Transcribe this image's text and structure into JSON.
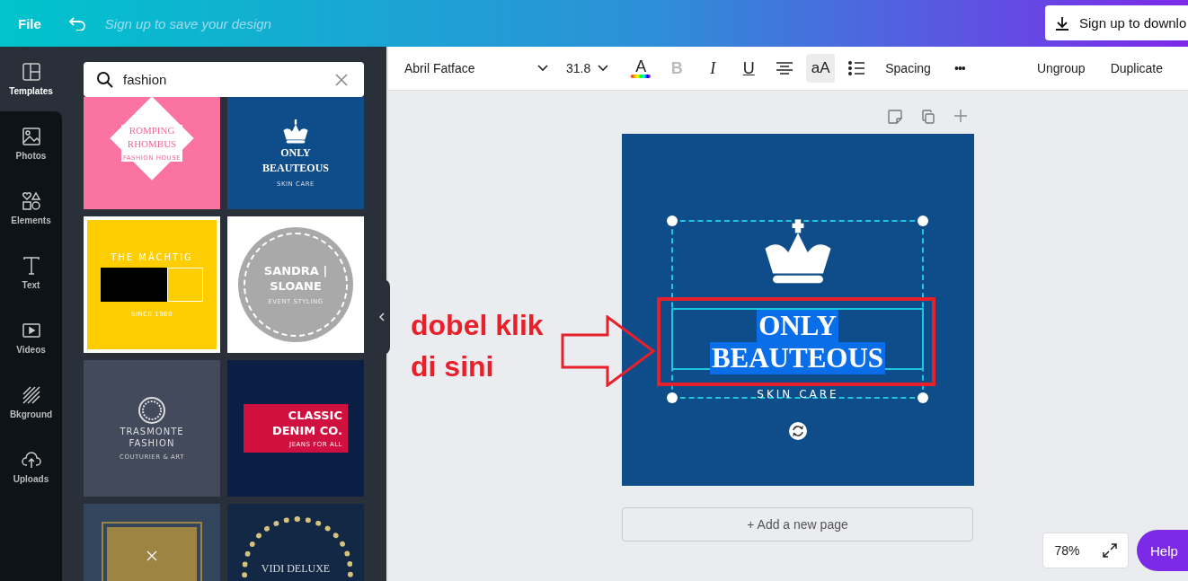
{
  "topbar": {
    "file_menu": "File",
    "hint": "Sign up to save your design",
    "signup_button": "Sign up to downlo"
  },
  "rail": [
    {
      "label": "Templates",
      "kind": "templates",
      "selected": true
    },
    {
      "label": "Photos",
      "kind": "photos",
      "selected": false
    },
    {
      "label": "Elements",
      "kind": "elements",
      "selected": false
    },
    {
      "label": "Text",
      "kind": "text",
      "selected": false
    },
    {
      "label": "Videos",
      "kind": "videos",
      "selected": false
    },
    {
      "label": "Bkground",
      "kind": "background",
      "selected": false
    },
    {
      "label": "Uploads",
      "kind": "uploads",
      "selected": false
    }
  ],
  "search": {
    "value": "fashion"
  },
  "templates": [
    {
      "kind": "diamond",
      "lines": [
        "ROMPING",
        "RHOMBUS"
      ],
      "tagline": "FASHION HOUSE"
    },
    {
      "kind": "crown",
      "lines": [
        "ONLY",
        "BEAUTEOUS"
      ],
      "tagline": "SKIN CARE"
    },
    {
      "kind": "blocks",
      "lines": [
        "THE MÄCHTIG"
      ],
      "tagline": "SINCE 1980"
    },
    {
      "kind": "badge",
      "lines": [
        "SANDRA |",
        "SLOANE"
      ],
      "tagline": "EVENT STYLING"
    },
    {
      "kind": "ring",
      "lines": [
        "TRASMONTE",
        "FASHION"
      ],
      "tagline": "COUTURIER & ART"
    },
    {
      "kind": "banner",
      "lines": [
        "CLASSIC",
        "DENIM CO."
      ],
      "tagline": "JEANS FOR ALL"
    },
    {
      "kind": "frame"
    },
    {
      "kind": "rope",
      "lines": [
        "VIDI DELUXE"
      ]
    }
  ],
  "toolbar": {
    "font": "Abril Fatface",
    "size": "31.8",
    "tools": [
      {
        "kind": "color",
        "label": "A",
        "selected": false,
        "disabled": false
      },
      {
        "kind": "bold",
        "label": "B",
        "selected": false,
        "disabled": true
      },
      {
        "kind": "italic",
        "label": "I",
        "selected": false,
        "disabled": false
      },
      {
        "kind": "underline",
        "label": "U",
        "selected": false,
        "disabled": false
      },
      {
        "kind": "align",
        "selected": false,
        "disabled": false
      },
      {
        "kind": "case",
        "label": "aA",
        "selected": true,
        "disabled": false
      },
      {
        "kind": "list",
        "selected": false,
        "disabled": false
      },
      {
        "kind": "spacing",
        "label": "Spacing",
        "selected": false,
        "disabled": false
      },
      {
        "kind": "more",
        "label": "•••",
        "selected": false,
        "disabled": false
      }
    ],
    "actions": [
      "Ungroup",
      "Duplicate"
    ]
  },
  "design": {
    "heading_lines": [
      "ONLY",
      "BEAUTEOUS"
    ],
    "subtitle": "SKIN CARE",
    "text_selected": true
  },
  "annotation": {
    "lines": [
      "dobel klik",
      "di sini"
    ]
  },
  "add_page": "+ Add a new page",
  "zoom": "78%",
  "help": "Help"
}
